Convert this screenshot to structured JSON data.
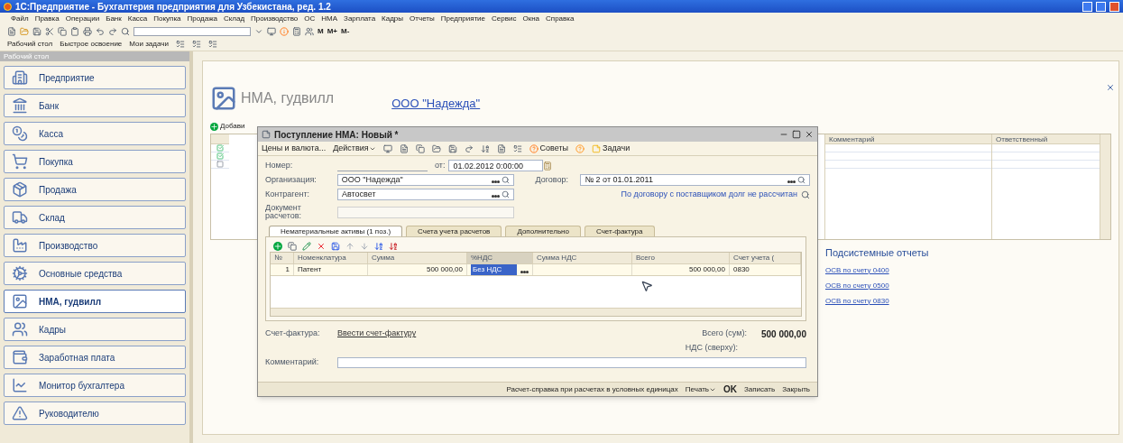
{
  "window": {
    "title": "1С:Предприятие - Бухгалтерия предприятия для Узбекистана, ред. 1.2"
  },
  "menu": [
    "Файл",
    "Правка",
    "Операции",
    "Банк",
    "Касса",
    "Покупка",
    "Продажа",
    "Склад",
    "Производство",
    "ОС",
    "НМА",
    "Зарплата",
    "Кадры",
    "Отчеты",
    "Предприятие",
    "Сервис",
    "Окна",
    "Справка"
  ],
  "toolbar": {
    "memory_buttons": [
      "M",
      "M+",
      "M-"
    ]
  },
  "panels_bar": [
    "Рабочий стол",
    "Быстрое освоение",
    "Мои задачи"
  ],
  "sidebar": {
    "title": "Рабочий стол",
    "items": [
      {
        "label": "Предприятие",
        "selected": false
      },
      {
        "label": "Банк",
        "selected": false
      },
      {
        "label": "Касса",
        "selected": false
      },
      {
        "label": "Покупка",
        "selected": false
      },
      {
        "label": "Продажа",
        "selected": false
      },
      {
        "label": "Склад",
        "selected": false
      },
      {
        "label": "Производство",
        "selected": false
      },
      {
        "label": "Основные средства",
        "selected": false
      },
      {
        "label": "НМА, гудвилл",
        "selected": true
      },
      {
        "label": "Кадры",
        "selected": false
      },
      {
        "label": "Заработная плата",
        "selected": false
      },
      {
        "label": "Монитор бухгалтера",
        "selected": false
      },
      {
        "label": "Руководителю",
        "selected": false
      }
    ]
  },
  "desktop": {
    "title": "НМА, гудвилл",
    "organization": "ООО \"Надежда\"",
    "add_button": "Добави",
    "list": {
      "columns": [
        "Комментарий",
        "Ответственный"
      ],
      "rows": [
        {
          "posted": true
        },
        {
          "posted": true
        },
        {
          "posted": false
        }
      ]
    },
    "reports": {
      "title": "Подсистемные отчеты",
      "links": [
        "ОСВ по счету 0400",
        "ОСВ по счету 0500",
        "ОСВ по счету 0830"
      ]
    }
  },
  "dialog": {
    "title": "Поступление НМА: Новый *",
    "toolbar": {
      "prices": "Цены и валюта...",
      "actions": "Действия",
      "tips": "Советы",
      "tasks": "Задачи"
    },
    "number": {
      "label": "Номер:"
    },
    "date": {
      "label": "от:",
      "value": "01.02.2012 0:00:00"
    },
    "organization": {
      "label": "Организация:",
      "value": "ООО \"Надежда\""
    },
    "contract": {
      "label": "Договор:",
      "value": "№ 2 от 01.01.2011"
    },
    "counterparty": {
      "label": "Контрагент:",
      "value": "Автосвет"
    },
    "debt_link": "По договору с поставщиком долг не рассчитан",
    "settlement_doc": {
      "label_1": "Документ",
      "label_2": "расчетов:"
    },
    "tabs": [
      {
        "label": "Нематериальные активы (1 поз.)",
        "selected": true
      },
      {
        "label": "Счета учета расчетов",
        "selected": false
      },
      {
        "label": "Дополнительно",
        "selected": false
      },
      {
        "label": "Счет-фактура",
        "selected": false
      }
    ],
    "table": {
      "columns": [
        "№",
        "Номенклатура",
        "Сумма",
        "%НДС",
        "Сумма НДС",
        "Всего",
        "Счет учета ("
      ],
      "rows": [
        {
          "cells": [
            "1",
            "Патент",
            "500 000,00",
            "Без НДС",
            "",
            "500 000,00",
            "0830"
          ],
          "selected": true
        }
      ]
    },
    "invoice": {
      "label": "Счет-фактура:",
      "link": "Ввести счет-фактуру"
    },
    "total": {
      "label": "Всего (сум):",
      "value": "500 000,00"
    },
    "vat": {
      "label": "НДС (сверху):"
    },
    "comment": {
      "label": "Комментарий:"
    },
    "footer": {
      "report": "Расчет-справка при расчетах в условных единицах",
      "print": "Печать",
      "ok": "OK",
      "save": "Записать",
      "close": "Закрыть"
    }
  }
}
